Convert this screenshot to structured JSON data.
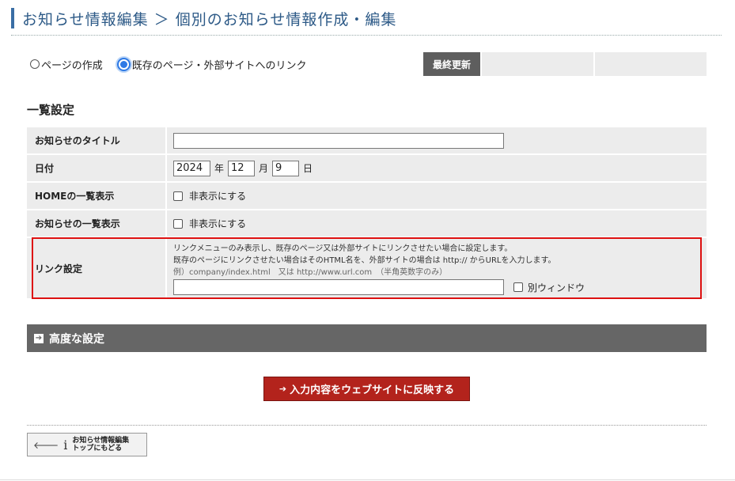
{
  "page": {
    "title": "お知らせ情報編集 ＞ 個別のお知らせ情報作成・編集"
  },
  "mode": {
    "option_create": "ページの作成",
    "option_link": "既存のページ・外部サイトへのリンク",
    "selected": "option_link"
  },
  "last_updated": {
    "label": "最終更新",
    "cells": [
      "",
      ""
    ]
  },
  "list_settings": {
    "heading": "一覧設定",
    "title_label": "お知らせのタイトル",
    "title_value": "",
    "date_label": "日付",
    "date_year": "2024",
    "date_year_unit": "年",
    "date_month": "12",
    "date_month_unit": "月",
    "date_day": "9",
    "date_day_unit": "日",
    "home_label": "HOMEの一覧表示",
    "home_checkbox_label": "非表示にする",
    "home_checked": false,
    "news_label": "お知らせの一覧表示",
    "news_checkbox_label": "非表示にする",
    "news_checked": false,
    "link_label": "リンク設定",
    "link_note_1": "リンクメニューのみ表示し、既存のページ又は外部サイトにリンクさせたい場合に設定します。",
    "link_note_2": "既存のページにリンクさせたい場合はそのHTML名を、外部サイトの場合は http:// からURLを入力します。",
    "link_example": "例）company/index.html　又は http://www.url.com　（半角英数字のみ）",
    "link_value": "",
    "new_window_label": "別ウィンドウ",
    "new_window_checked": false
  },
  "advanced": {
    "label": "高度な設定"
  },
  "submit": {
    "label": "入力内容をウェブサイトに反映する"
  },
  "back": {
    "line1": "お知らせ情報編集",
    "line2": "トップにもどる"
  },
  "colors": {
    "title": "#2d5a87",
    "accent": "#3a6ea5",
    "submit": "#b3231c",
    "highlight": "#dd1111",
    "advanced_bar": "#666666"
  }
}
